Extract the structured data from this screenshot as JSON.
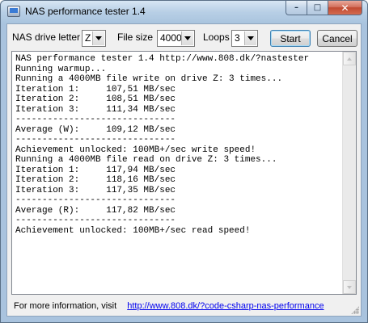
{
  "window": {
    "title": "NAS performance tester 1.4",
    "icon": "app-window-icon",
    "caption_buttons": {
      "minimize": "–",
      "maximize": "□",
      "close": "✕"
    }
  },
  "toolbar": {
    "drive_label": "NAS drive letter",
    "drive_value": "Z",
    "filesize_label": "File size",
    "filesize_value": "4000",
    "loops_label": "Loops",
    "loops_value": "3",
    "start_label": "Start",
    "cancel_label": "Cancel"
  },
  "output": {
    "lines": [
      "NAS performance tester 1.4 http://www.808.dk/?nastester",
      "Running warmup...",
      "Running a 4000MB file write on drive Z: 3 times...",
      "Iteration 1:     107,51 MB/sec",
      "Iteration 2:     108,51 MB/sec",
      "Iteration 3:     111,34 MB/sec",
      "------------------------------",
      "Average (W):     109,12 MB/sec",
      "------------------------------",
      "Achievement unlocked: 100MB+/sec write speed!",
      "Running a 4000MB file read on drive Z: 3 times...",
      "Iteration 1:     117,94 MB/sec",
      "Iteration 2:     118,16 MB/sec",
      "Iteration 3:     117,35 MB/sec",
      "------------------------------",
      "Average (R):     117,82 MB/sec",
      "------------------------------",
      "Achievement unlocked: 100MB+/sec read speed!"
    ]
  },
  "footer": {
    "text": "For more information, visit",
    "link": "http://www.808.dk/?code-csharp-nas-performance"
  }
}
